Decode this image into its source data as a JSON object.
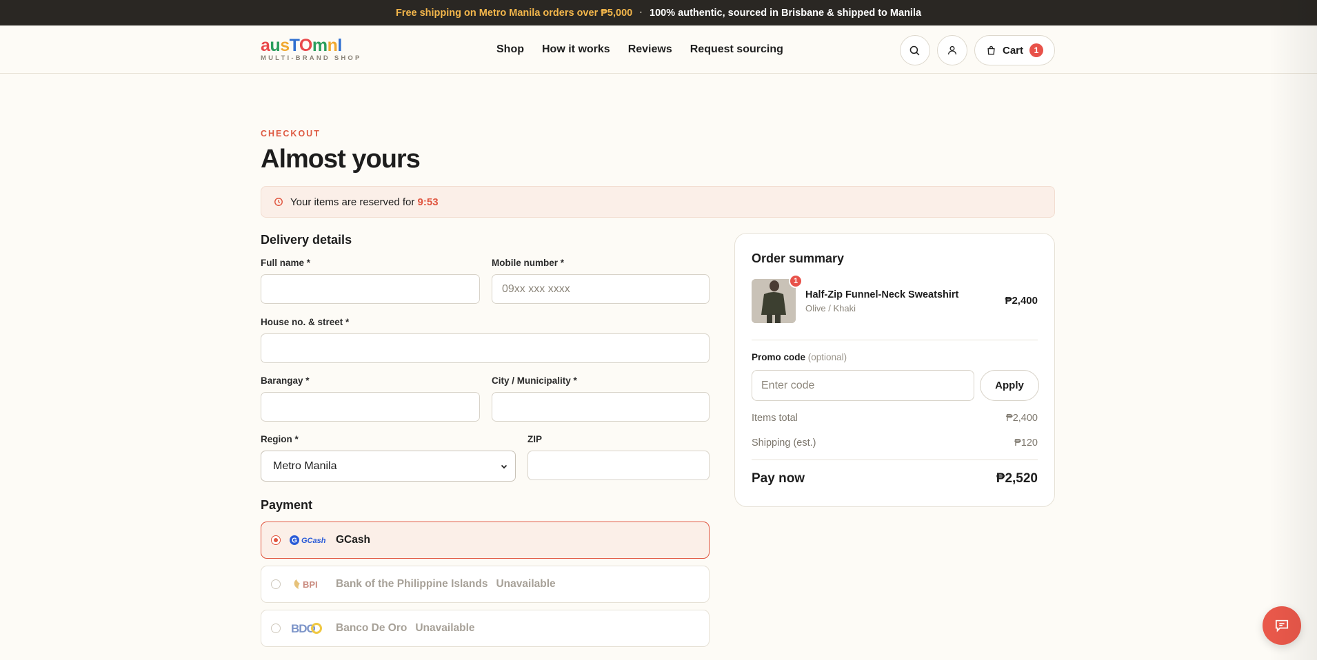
{
  "announcement": {
    "highlight": "Free shipping on Metro Manila orders over ₱5,000",
    "separator": "·",
    "message": "100% authentic, sourced in Brisbane & shipped to Manila"
  },
  "header": {
    "logo": {
      "letters": [
        {
          "char": "a",
          "color": "#e9484a"
        },
        {
          "char": "u",
          "color": "#2a9d5c"
        },
        {
          "char": "s",
          "color": "#f0a830"
        },
        {
          "char": "T",
          "color": "#2f6fd0"
        },
        {
          "char": "O",
          "color": "#e9484a"
        },
        {
          "char": "m",
          "color": "#2a9d5c"
        },
        {
          "char": "n",
          "color": "#f0a830"
        },
        {
          "char": "l",
          "color": "#2f6fd0"
        }
      ],
      "tagline": "MULTI-BRAND SHOP"
    },
    "nav": [
      "Shop",
      "How it works",
      "Reviews",
      "Request sourcing"
    ],
    "cart_label": "Cart",
    "cart_count": "1"
  },
  "checkout": {
    "eyebrow": "CHECKOUT",
    "title": "Almost yours",
    "reserve_text": "Your items are reserved for",
    "reserve_time": "9:53"
  },
  "delivery": {
    "title": "Delivery details",
    "full_name_label": "Full name *",
    "mobile_label": "Mobile number *",
    "mobile_placeholder": "09xx xxx xxxx",
    "street_label": "House no. & street *",
    "barangay_label": "Barangay *",
    "city_label": "City / Municipality *",
    "region_label": "Region *",
    "region_value": "Metro Manila",
    "zip_label": "ZIP"
  },
  "payment": {
    "title": "Payment",
    "options": [
      {
        "name": "GCash",
        "logo_text": "GCash",
        "selected": true,
        "status": ""
      },
      {
        "name": "Bank of the Philippine Islands",
        "logo_text": "BPI",
        "selected": false,
        "status": "Unavailable"
      },
      {
        "name": "Banco De Oro",
        "logo_text": "BDO",
        "selected": false,
        "status": "Unavailable"
      }
    ]
  },
  "summary": {
    "title": "Order summary",
    "item": {
      "qty": "1",
      "name": "Half-Zip Funnel-Neck Sweatshirt",
      "variant": "Olive / Khaki",
      "price": "₱2,400"
    },
    "promo_label": "Promo code",
    "promo_optional": "(optional)",
    "promo_placeholder": "Enter code",
    "apply_label": "Apply",
    "items_total_label": "Items total",
    "items_total_value": "₱2,400",
    "shipping_label": "Shipping (est.)",
    "shipping_value": "₱120",
    "pay_now_label": "Pay now",
    "pay_now_value": "₱2,520"
  },
  "colors": {
    "accent": "#e0553f",
    "topbar": "#2a2723",
    "background": "#fdfbf6"
  }
}
